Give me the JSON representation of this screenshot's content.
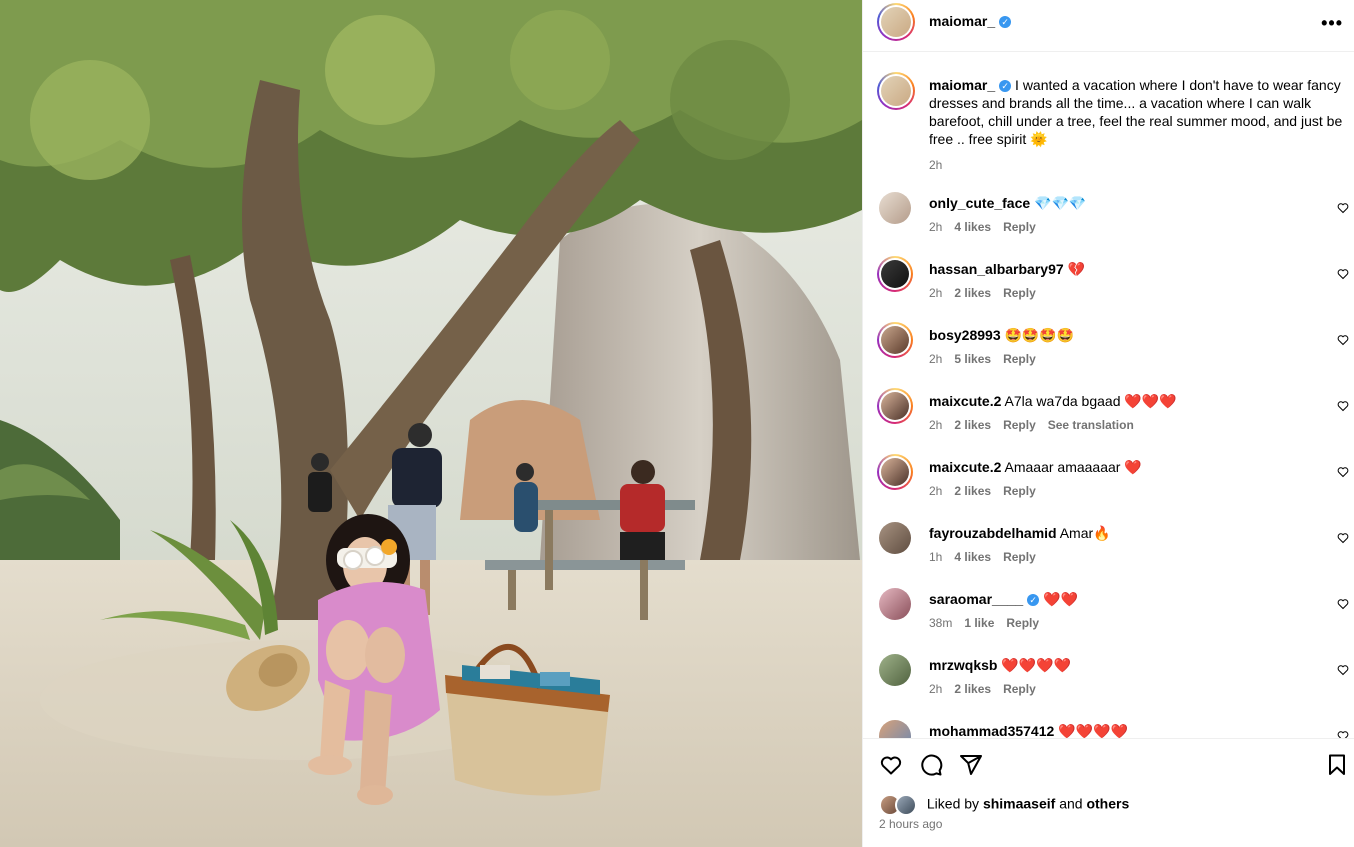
{
  "colors": {
    "accent_blue": "#3897f0",
    "muted_text": "#737373",
    "heart_red": "#ed2d3f",
    "divider": "#efefef"
  },
  "header": {
    "username": "maiomar_",
    "verified_icon": "verified-badge-icon",
    "more_icon": "more-options-icon"
  },
  "caption": {
    "username": "maiomar_",
    "text": "I wanted a vacation where I don't have to wear fancy dresses and brands all the time... a vacation where I can walk barefoot, chill under a tree, feel the real summer mood, and just be free .. free spirit 🌞",
    "time": "2h"
  },
  "comments": [
    {
      "username": "only_cute_face",
      "text": "💎💎💎",
      "time": "2h",
      "likes": "4 likes",
      "reply": "Reply"
    },
    {
      "username": "hassan_albarbary97",
      "text": "💔",
      "time": "2h",
      "likes": "2 likes",
      "reply": "Reply"
    },
    {
      "username": "bosy28993",
      "text": "🤩🤩🤩🤩",
      "time": "2h",
      "likes": "5 likes",
      "reply": "Reply"
    },
    {
      "username": "maixcute.2",
      "text": "A7la wa7da bgaad ❤️❤️❤️",
      "time": "2h",
      "likes": "2 likes",
      "reply": "Reply",
      "translation": "See translation"
    },
    {
      "username": "maixcute.2",
      "text": "Amaaar amaaaaar ❤️",
      "time": "2h",
      "likes": "2 likes",
      "reply": "Reply"
    },
    {
      "username": "fayrouzabdelhamid",
      "text": "Amar🔥",
      "time": "1h",
      "likes": "4 likes",
      "reply": "Reply"
    },
    {
      "username": "saraomar____",
      "text": "❤️❤️",
      "time": "38m",
      "likes": "1 like",
      "reply": "Reply"
    },
    {
      "username": "mrzwqksb",
      "text": "❤️❤️❤️❤️",
      "time": "2h",
      "likes": "2 likes",
      "reply": "Reply"
    },
    {
      "username": "mohammad357412",
      "text": "❤️❤️❤️❤️"
    }
  ],
  "actions": {
    "like_icon": "heart-icon",
    "comment_icon": "comment-icon",
    "share_icon": "share-icon",
    "save_icon": "bookmark-icon"
  },
  "likes_summary": {
    "prefix": "Liked by",
    "user": "shimaaseif",
    "conjunction": "and",
    "others": "others"
  },
  "posted_ago": "2 hours ago"
}
